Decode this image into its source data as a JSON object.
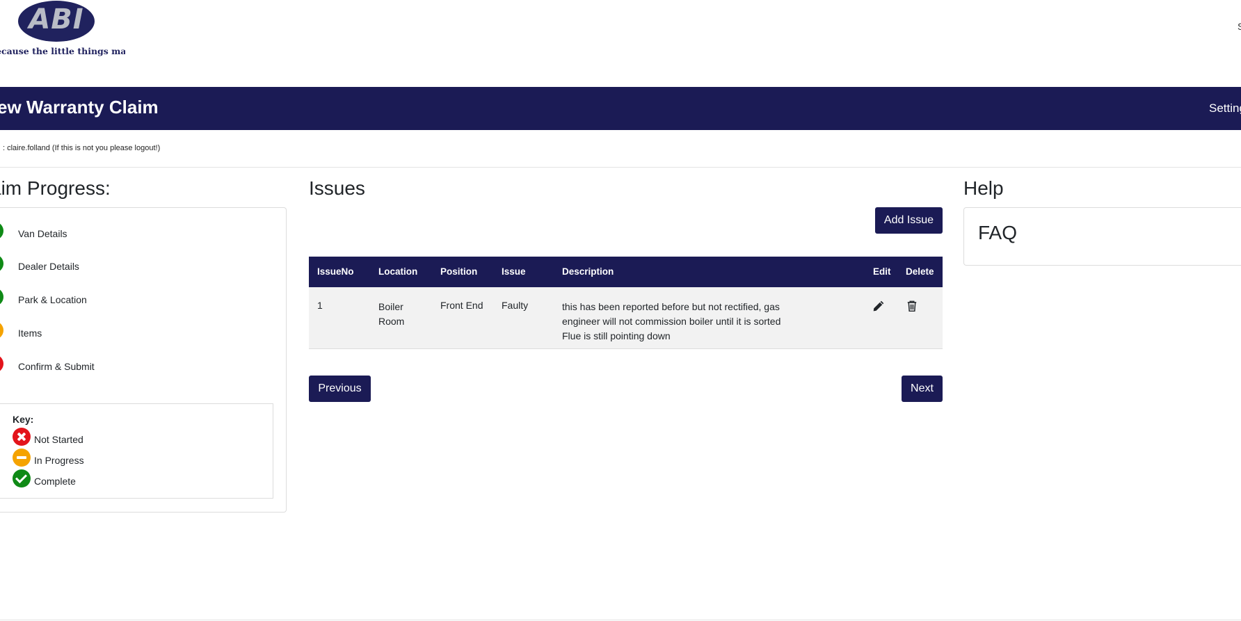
{
  "logo": {
    "text": "ABI",
    "tagline": "ecause the little things matter"
  },
  "top_right_text": "S",
  "header": {
    "title": "ew Warranty Claim",
    "settings_label": "Setting"
  },
  "user_line": ": claire.folland (If this is not you please logout!)",
  "progress": {
    "title": "aim Progress:",
    "steps": [
      {
        "label": "Van Details",
        "status": "complete"
      },
      {
        "label": "Dealer Details",
        "status": "complete"
      },
      {
        "label": "Park & Location",
        "status": "complete"
      },
      {
        "label": "Items",
        "status": "in-progress"
      },
      {
        "label": "Confirm & Submit",
        "status": "not-started"
      }
    ],
    "key": {
      "title": "Key:",
      "not_started": "Not Started",
      "in_progress": "In Progress",
      "complete": "Complete"
    }
  },
  "issues": {
    "title": "Issues",
    "add_button": "Add Issue",
    "columns": [
      "IssueNo",
      "Location",
      "Position",
      "Issue",
      "Description",
      "Edit",
      "Delete"
    ],
    "rows": [
      {
        "issue_no": "1",
        "location": "Boiler Room",
        "position": "Front End",
        "issue": "Faulty",
        "description": "this has been reported before but not rectified, gas engineer will not commission boiler until it is sorted Flue is still pointing down",
        "edit_icon": "pencil-icon",
        "delete_icon": "trash-icon"
      }
    ],
    "previous_button": "Previous",
    "next_button": "Next"
  },
  "help": {
    "title": "Help",
    "faq": "FAQ"
  },
  "colors": {
    "brand_navy": "#1b1b55",
    "complete_green": "#0f8a16",
    "in_progress_orange": "#f5a300",
    "not_started_red": "#e3141b"
  }
}
